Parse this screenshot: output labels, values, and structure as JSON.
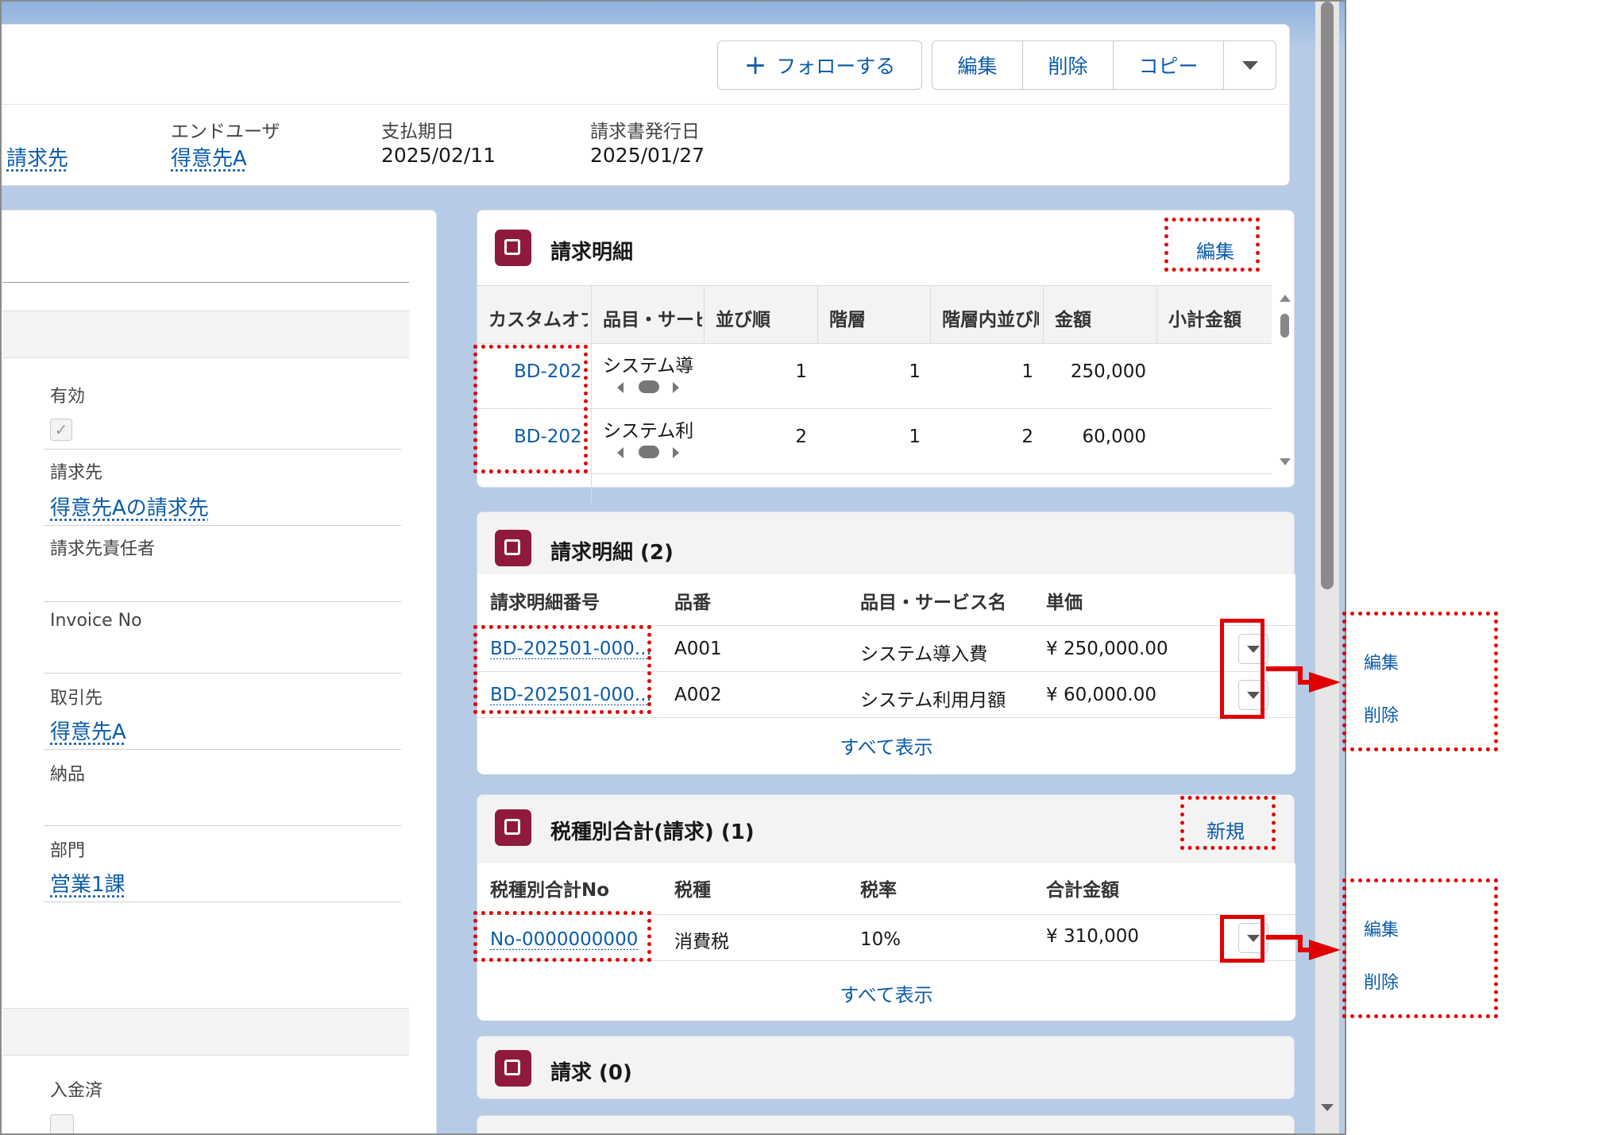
{
  "header": {
    "follow_label": "フォローする",
    "edit_label": "編集",
    "delete_label": "削除",
    "copy_label": "コピー",
    "fields": [
      {
        "label": "",
        "value": "請求先"
      },
      {
        "label": "エンドユーザ",
        "value": "得意先A"
      },
      {
        "label": "支払期日",
        "value": "2025/02/11"
      },
      {
        "label": "請求書発行日",
        "value": "2025/01/27"
      }
    ]
  },
  "details": {
    "active_label": "有効",
    "billto_label": "請求先",
    "billto_value": "得意先Aの請求先",
    "billto_person_label": "請求先責任者",
    "invoice_no_label": "Invoice No",
    "account_label": "取引先",
    "account_value": "得意先A",
    "delivery_label": "納品",
    "dept_label": "部門",
    "dept_value": "営業1課",
    "paid_label": "入金済"
  },
  "editable_list": {
    "title": "請求明細",
    "edit_label": "編集",
    "columns": [
      "カスタムオブ",
      "品目・サービ",
      "並び順",
      "階層",
      "階層内並び順",
      "金額",
      "小計金額"
    ],
    "rows": [
      {
        "id": "BD-202",
        "name": "システム導",
        "order": "1",
        "level": "1",
        "inner": "1",
        "amount": "250,000",
        "subtotal": ""
      },
      {
        "id": "BD-202",
        "name": "システム利",
        "order": "2",
        "level": "1",
        "inner": "2",
        "amount": "60,000",
        "subtotal": ""
      }
    ]
  },
  "related_lines": {
    "title": "請求明細 (2)",
    "columns": [
      "請求明細番号",
      "品番",
      "品目・サービス名",
      "単価"
    ],
    "rows": [
      {
        "id": "BD-202501-000...",
        "code": "A001",
        "name": "システム導入費",
        "price": "¥ 250,000.00"
      },
      {
        "id": "BD-202501-000...",
        "code": "A002",
        "name": "システム利用月額",
        "price": "¥ 60,000.00"
      }
    ],
    "view_all": "すべて表示"
  },
  "tax_totals": {
    "title": "税種別合計(請求) (1)",
    "new_label": "新規",
    "columns": [
      "税種別合計No",
      "税種",
      "税率",
      "合計金額"
    ],
    "rows": [
      {
        "id": "No-0000000000",
        "type": "消費税",
        "rate": "10%",
        "total": "¥ 310,000"
      }
    ],
    "view_all": "すべて表示"
  },
  "invoices": {
    "title": "請求 (0)"
  },
  "callouts": [
    {
      "edit": "編集",
      "delete": "削除"
    },
    {
      "edit": "編集",
      "delete": "削除"
    }
  ],
  "colors": {
    "accent": "#0b5cab",
    "icon": "#8f1a3c",
    "annotation": "#e00000"
  }
}
